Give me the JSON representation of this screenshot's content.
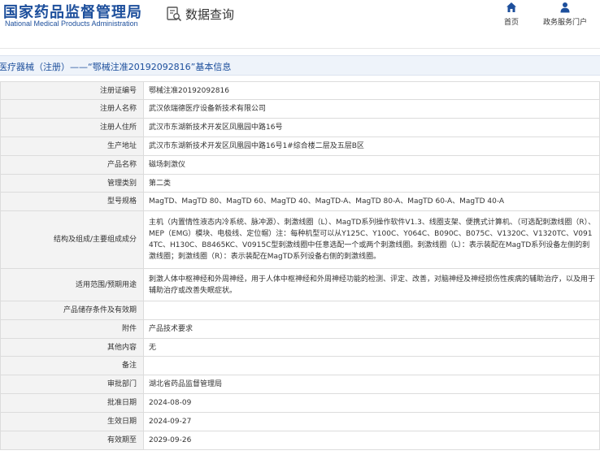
{
  "header": {
    "logo_cn": "国家药品监督管理局",
    "logo_en": "National Medical Products Administration",
    "page_name": "数据查询",
    "nav": [
      {
        "label": "首页",
        "icon": "home-icon"
      },
      {
        "label": "政务服务门户",
        "icon": "person-icon"
      }
    ],
    "accent_color": "#1d4f9c"
  },
  "title_bar": {
    "text": "医疗器械（注册）——“鄂械注准20192092816”基本信息"
  },
  "rows": [
    {
      "label": "注册证编号",
      "value": "鄂械注准20192092816"
    },
    {
      "label": "注册人名称",
      "value": "武汉依瑞德医疗设备新技术有限公司"
    },
    {
      "label": "注册人住所",
      "value": "武汉市东湖新技术开发区凤凰园中路16号"
    },
    {
      "label": "生产地址",
      "value": "武汉市东湖新技术开发区凤凰园中路16号1#综合楼二层及五层B区"
    },
    {
      "label": "产品名称",
      "value": "磁场刺激仪"
    },
    {
      "label": "管理类别",
      "value": "第二类"
    },
    {
      "label": "型号规格",
      "value": "MagTD、MagTD 80、MagTD 60、MagTD 40、MagTD-A、MagTD 80-A、MagTD 60-A、MagTD 40-A"
    },
    {
      "label": "结构及组成/主要组成成分",
      "value": "主机（内置情性液态内冷系统、脉冲源）、刺激线圈（L）、MagTD系列操作软件V1.3、线圈支架、便携式计算机、（可选配刺激线圈（R）、MEP（EMG）模块、电极线、定位帽）注：每种机型可以从Y125C、Y100C、Y064C、B090C、B075C、V1320C、V1320TC、V0914TC、H130C、B8465KC、V0915C型刺激线圈中任意选配一个或两个刺激线圈。刺激线圈（L）：表示装配在MagTD系列设备左侧的刺激线圈；刺激线圈（R）：表示装配在MagTD系列设备右侧的刺激线圈。"
    },
    {
      "label": "适用范围/预期用途",
      "value": "刺激人体中枢神经和外周神经，用于人体中枢神经和外周神经功能的检测、评定、改善，对脑神经及神经损伤性疾病的辅助治疗，以及用于辅助治疗或改善失眠症状。"
    },
    {
      "label": "产品储存条件及有效期",
      "value": ""
    },
    {
      "label": "附件",
      "value": "产品技术要求"
    },
    {
      "label": "其他内容",
      "value": "无"
    },
    {
      "label": "备注",
      "value": ""
    },
    {
      "label": "审批部门",
      "value": "湖北省药品监督管理局"
    },
    {
      "label": "批准日期",
      "value": "2024-08-09"
    },
    {
      "label": "生效日期",
      "value": "2024-09-27"
    },
    {
      "label": "有效期至",
      "value": "2029-09-26"
    }
  ]
}
